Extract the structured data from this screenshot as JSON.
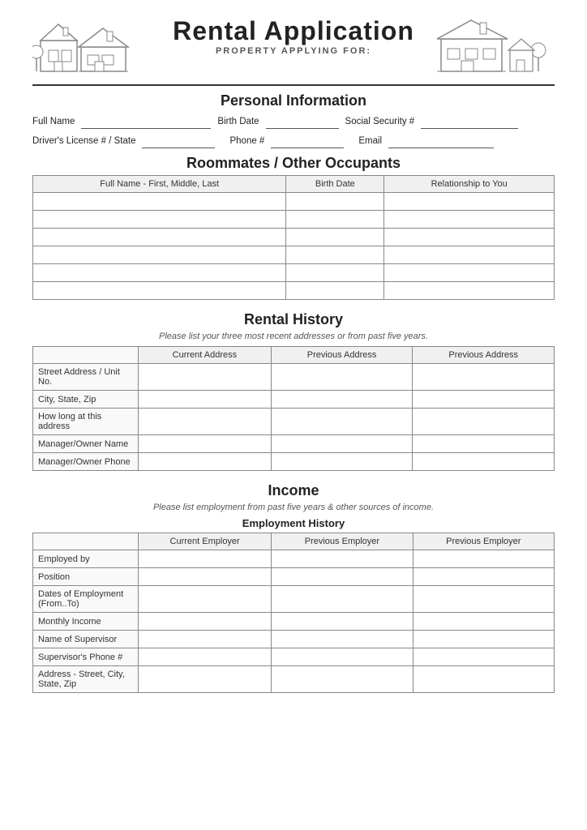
{
  "header": {
    "title": "Rental Application",
    "subtitle": "PROPERTY APPLYING FOR:"
  },
  "personal_info": {
    "section_title": "Personal Information",
    "fields": {
      "full_name_label": "Full Name",
      "birth_date_label": "Birth Date",
      "ssn_label": "Social Security #",
      "drivers_license_label": "Driver's License # / State",
      "phone_label": "Phone #",
      "email_label": "Email"
    }
  },
  "roommates": {
    "section_title": "Roommates / Other Occupants",
    "columns": [
      "Full Name - First, Middle, Last",
      "Birth Date",
      "Relationship to You"
    ],
    "rows": 6
  },
  "rental_history": {
    "section_title": "Rental History",
    "subtitle": "Please list your three most recent addresses or from past five years.",
    "columns": [
      "",
      "Current Address",
      "Previous Address",
      "Previous Address"
    ],
    "rows": [
      "Street Address / Unit No.",
      "City, State, Zip",
      "How long at this address",
      "Manager/Owner Name",
      "Manager/Owner Phone"
    ]
  },
  "income": {
    "section_title": "Income",
    "subtitle": "Please list employment from past five years & other sources of income.",
    "employment_history": {
      "subsection_title": "Employment History",
      "columns": [
        "",
        "Current Employer",
        "Previous Employer",
        "Previous Employer"
      ],
      "rows": [
        "Employed by",
        "Position",
        "Dates of Employment (From..To)",
        "Monthly Income",
        "Name of Supervisor",
        "Supervisor's Phone #",
        "Address - Street, City, State, Zip"
      ]
    }
  }
}
